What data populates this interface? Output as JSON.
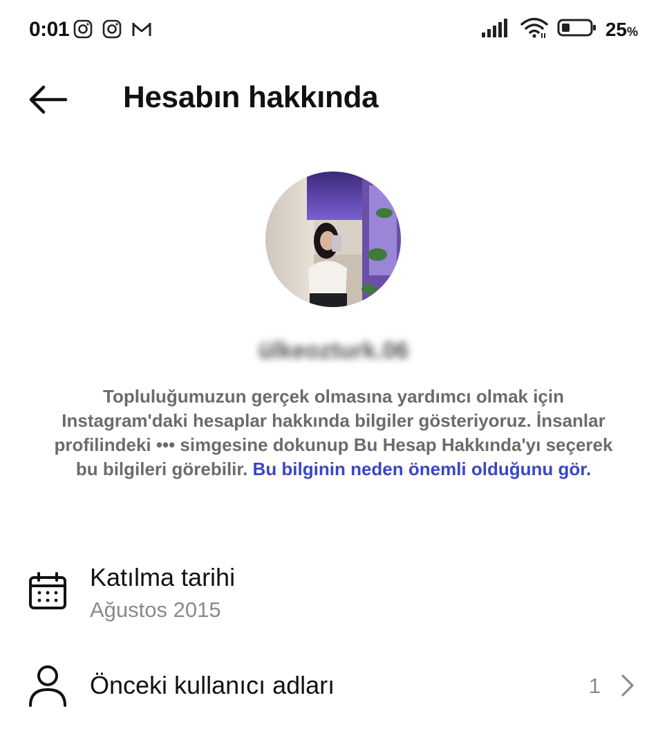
{
  "status_bar": {
    "time": "0:01",
    "left_icons": [
      "instagram-icon",
      "instagram-icon",
      "gmail-icon"
    ],
    "right_icons": [
      "signal-icon",
      "wifi-icon",
      "battery-icon"
    ],
    "battery_level": "25",
    "battery_unit": "%"
  },
  "header": {
    "title": "Hesabın hakkında"
  },
  "profile": {
    "username": "ülkeozturk.06"
  },
  "description": {
    "text": "Topluluğumuzun gerçek olmasına yardımcı olmak için Instagram'daki hesaplar hakkında bilgiler gösteriyoruz. İnsanlar profilindeki ••• simgesine dokunup Bu Hesap Hakkında'yı seçerek bu bilgileri görebilir.",
    "link_text": "Bu bilginin neden önemli olduğunu gör.",
    "link_color": "#3b45c9"
  },
  "rows": {
    "join_date": {
      "title": "Katılma tarihi",
      "value": "Ağustos 2015",
      "icon": "calendar-icon"
    },
    "previous_usernames": {
      "title": "Önceki kullanıcı adları",
      "count": "1",
      "icon": "user-icon"
    }
  }
}
